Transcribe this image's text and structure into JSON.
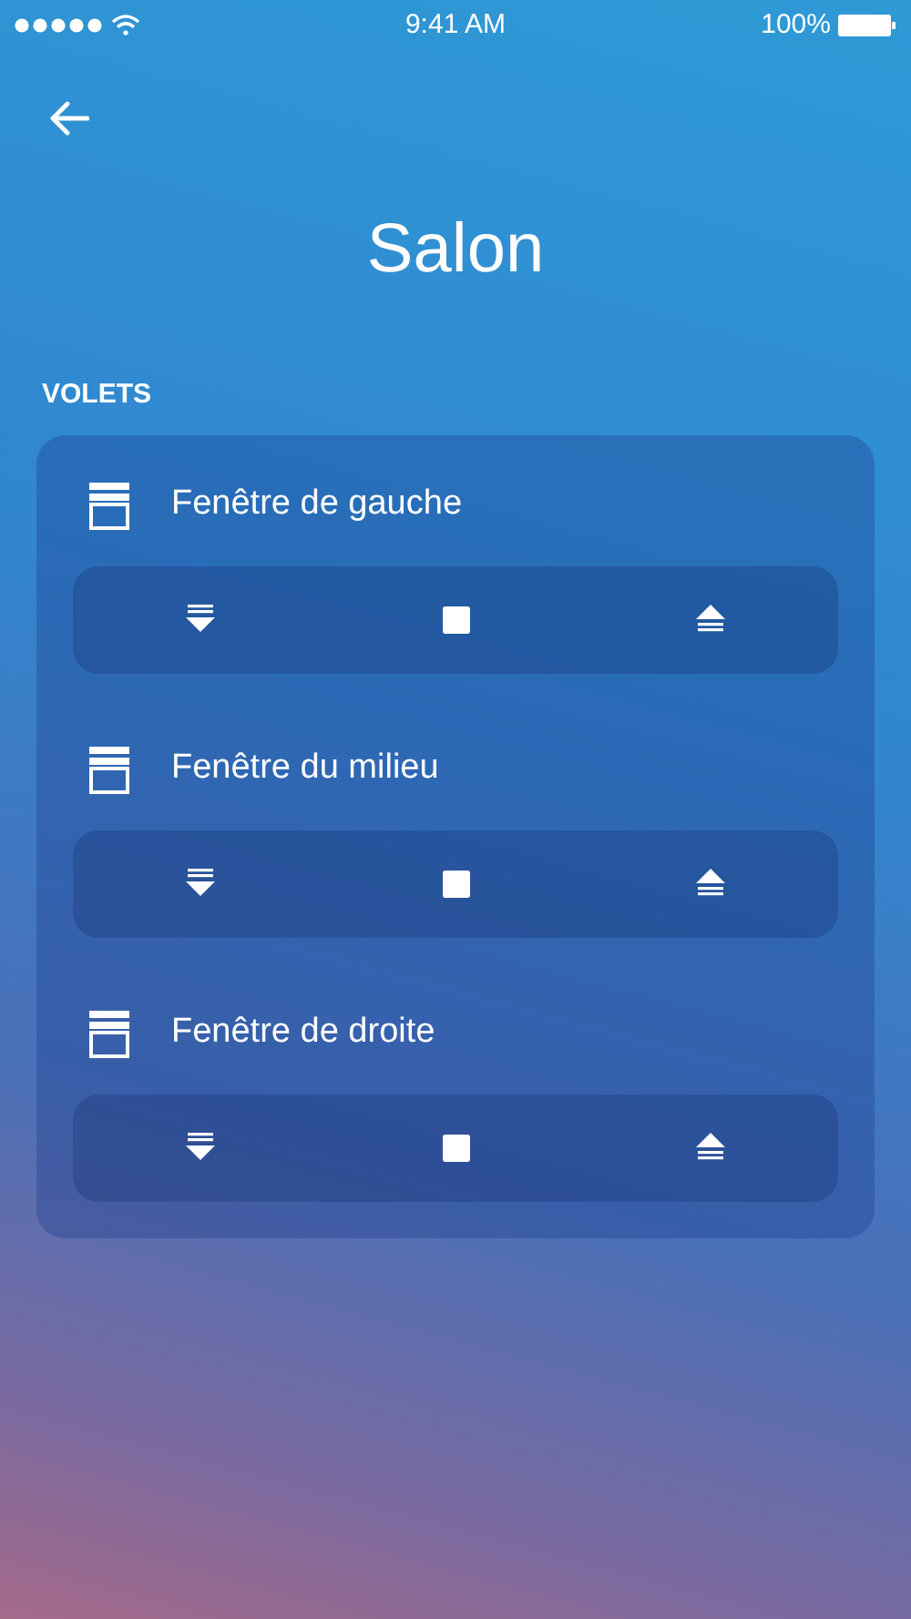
{
  "status_bar": {
    "time": "9:41 AM",
    "battery": "100%"
  },
  "header": {
    "title": "Salon"
  },
  "section": {
    "title": "VOLETS"
  },
  "shutters": [
    {
      "name": "Fenêtre de gauche"
    },
    {
      "name": "Fenêtre du milieu"
    },
    {
      "name": "Fenêtre de droite"
    }
  ]
}
